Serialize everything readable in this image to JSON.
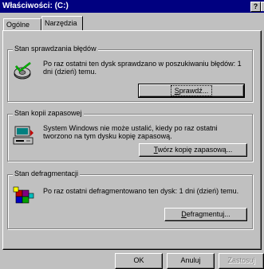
{
  "window": {
    "title": "Właściwości: (C:)",
    "help_glyph": "?"
  },
  "tabs": [
    {
      "label": "Ogólne",
      "active": false
    },
    {
      "label": "Narzędzia",
      "active": true
    }
  ],
  "groups": {
    "error_check": {
      "label": "Stan sprawdzania błędów",
      "text": "Po raz ostatni ten dysk sprawdzano w poszukiwaniu błędów: 1 dni (dzień) temu.",
      "button_pre": "",
      "button_mnemonic": "S",
      "button_post": "prawdź..."
    },
    "backup": {
      "label": "Stan kopii zapasowej",
      "text": "System Windows nie może ustalić, kiedy po raz ostatni tworzono na tym dysku kopię zapasową.",
      "button_pre": "",
      "button_mnemonic": "T",
      "button_post": "wórz kopię zapasową..."
    },
    "defrag": {
      "label": "Stan defragmentacji",
      "text": "Po raz ostatni defragmentowano ten dysk: 1 dni (dzień) temu.",
      "button_pre": "",
      "button_mnemonic": "D",
      "button_post": "efragmentuj..."
    }
  },
  "footer": {
    "ok": "OK",
    "cancel": "Anuluj",
    "apply": "Zastosuj"
  }
}
